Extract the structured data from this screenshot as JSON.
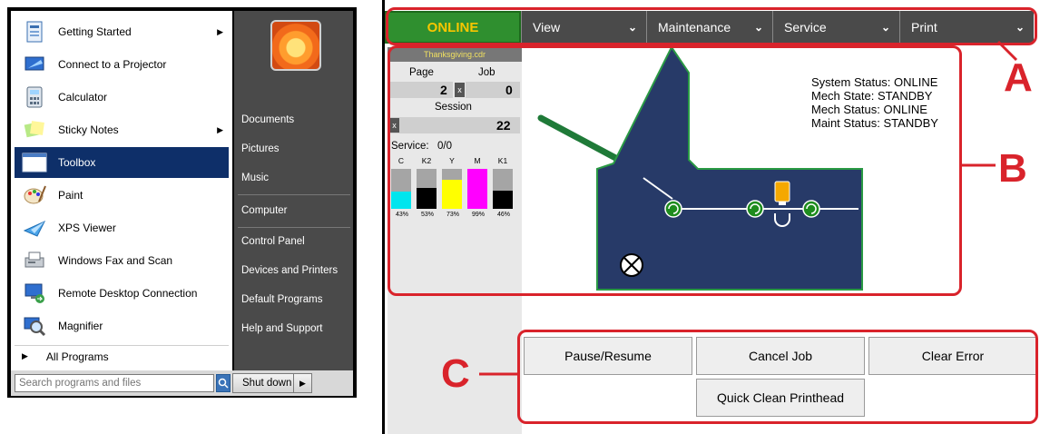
{
  "start_menu": {
    "programs": [
      {
        "label": "Getting Started",
        "icon": "getting-started-icon",
        "has_arrow": true,
        "selected": false
      },
      {
        "label": "Connect to a Projector",
        "icon": "projector-icon",
        "has_arrow": false,
        "selected": false
      },
      {
        "label": "Calculator",
        "icon": "calculator-icon",
        "has_arrow": false,
        "selected": false
      },
      {
        "label": "Sticky Notes",
        "icon": "sticky-notes-icon",
        "has_arrow": true,
        "selected": false
      },
      {
        "label": "Toolbox",
        "icon": "toolbox-icon",
        "has_arrow": false,
        "selected": true
      },
      {
        "label": "Paint",
        "icon": "paint-icon",
        "has_arrow": false,
        "selected": false
      },
      {
        "label": "XPS Viewer",
        "icon": "xps-viewer-icon",
        "has_arrow": false,
        "selected": false
      },
      {
        "label": "Windows Fax and Scan",
        "icon": "fax-scan-icon",
        "has_arrow": false,
        "selected": false
      },
      {
        "label": "Remote Desktop Connection",
        "icon": "remote-desktop-icon",
        "has_arrow": false,
        "selected": false
      },
      {
        "label": "Magnifier",
        "icon": "magnifier-icon",
        "has_arrow": false,
        "selected": false
      }
    ],
    "all_programs": "All Programs",
    "right_links": [
      "Documents",
      "Pictures",
      "Music",
      "Computer",
      "Control Panel",
      "Devices and Printers",
      "Default Programs",
      "Help and Support"
    ],
    "search_placeholder": "Search programs and files",
    "shutdown_label": "Shut down"
  },
  "printer": {
    "status": "ONLINE",
    "menus": [
      "View",
      "Maintenance",
      "Service",
      "Print"
    ],
    "job_file": "Thanksgiving.cdr",
    "page_label": "Page",
    "job_label": "Job",
    "page_value": "2",
    "job_value": "0",
    "session_label": "Session",
    "session_value": "22",
    "x_glyph": "x",
    "service_label": "Service:",
    "service_value": "0/0",
    "inks": [
      {
        "name": "C",
        "percent": 43,
        "color": "#00e5ee"
      },
      {
        "name": "K2",
        "percent": 53,
        "color": "#000000"
      },
      {
        "name": "Y",
        "percent": 73,
        "color": "#ffff00"
      },
      {
        "name": "M",
        "percent": 99,
        "color": "#ff00ff"
      },
      {
        "name": "K1",
        "percent": 46,
        "color": "#000000"
      }
    ],
    "ink_pct_labels": [
      "43%",
      "53%",
      "73%",
      "99%",
      "46%"
    ],
    "system_status": [
      {
        "label": "System Status:",
        "value": "ONLINE"
      },
      {
        "label": "Mech State:",
        "value": "STANDBY"
      },
      {
        "label": "Mech Status:",
        "value": "ONLINE"
      },
      {
        "label": "Maint Status:",
        "value": "STANDBY"
      }
    ],
    "actions": {
      "pause_resume": "Pause/Resume",
      "cancel_job": "Cancel Job",
      "clear_error": "Clear Error",
      "quick_clean": "Quick Clean Printhead"
    },
    "callouts": {
      "a": "A",
      "b": "B",
      "c": "C"
    },
    "colors": {
      "accent_red": "#d9232b",
      "status_green": "#2f8f2f",
      "status_text": "#f7c600",
      "mech_body": "#273a68"
    }
  }
}
